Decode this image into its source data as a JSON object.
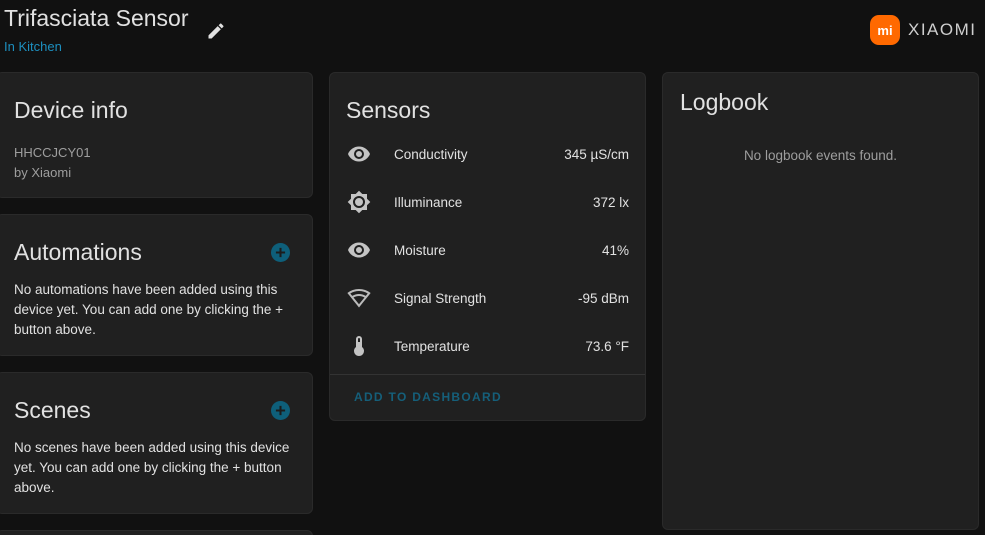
{
  "header": {
    "title": "Trifasciata Sensor",
    "area": "In Kitchen",
    "edit_icon": "pencil-icon",
    "brand": {
      "logo_text": "mi",
      "wordmark": "XIAOMI",
      "color": "#ff6900"
    }
  },
  "device_info": {
    "title": "Device info",
    "model": "HHCCJCY01",
    "manufacturer": "by Xiaomi"
  },
  "automations": {
    "title": "Automations",
    "add_icon": "plus-circle-icon",
    "empty_text": "No automations have been added using this device yet. You can add one by clicking the + button above."
  },
  "scenes": {
    "title": "Scenes",
    "add_icon": "plus-circle-icon",
    "empty_text": "No scenes have been added using this device yet. You can add one by clicking the + button above."
  },
  "sensors": {
    "title": "Sensors",
    "items": [
      {
        "icon": "eye-icon",
        "name": "Conductivity",
        "value": "345 µS/cm"
      },
      {
        "icon": "sun-icon",
        "name": "Illuminance",
        "value": "372 lx"
      },
      {
        "icon": "eye-icon",
        "name": "Moisture",
        "value": "41%"
      },
      {
        "icon": "wifi-icon",
        "name": "Signal Strength",
        "value": "-95 dBm"
      },
      {
        "icon": "thermometer-icon",
        "name": "Temperature",
        "value": "73.6 °F"
      }
    ],
    "add_to_dashboard": "ADD TO DASHBOARD"
  },
  "logbook": {
    "title": "Logbook",
    "empty_text": "No logbook events found."
  },
  "colors": {
    "background": "#111111",
    "card": "#202020",
    "accent": "#0e5f7a",
    "link": "#1d8fbf"
  }
}
